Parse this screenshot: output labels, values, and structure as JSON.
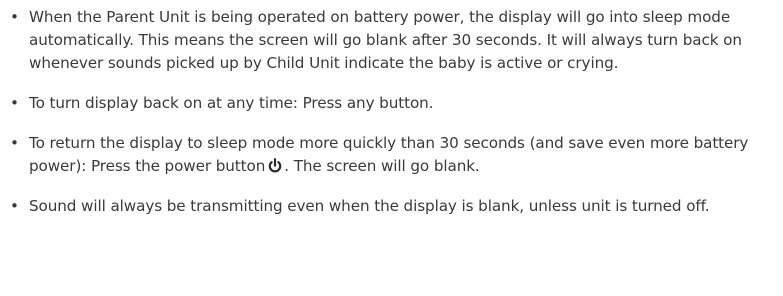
{
  "bullets": [
    {
      "text": "When the Parent Unit is being operated on battery power, the display will go into sleep mode automatically. This means the screen will go blank after 30 seconds. It will always turn back on whenever sounds picked up by Child Unit indicate the baby is active or crying."
    },
    {
      "text": "To turn display back on at any time: Press any button."
    },
    {
      "text_before_icon": "To return the display to sleep mode more quickly than 30 seconds (and save even more battery power): Press the power button",
      "icon": "power-icon",
      "text_after_icon": ". The screen will go blank."
    },
    {
      "text": "Sound will always be transmitting even when the display is blank, unless unit is turned off."
    }
  ],
  "bullet_symbol": "•"
}
